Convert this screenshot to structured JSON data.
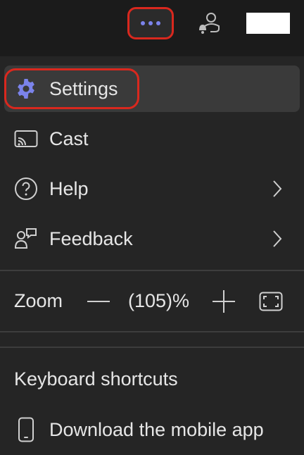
{
  "topbar": {
    "more_icon": "more-horizontal-icon",
    "person_icon": "person-notification-icon"
  },
  "menu": {
    "items": [
      {
        "label": "Settings",
        "icon": "gear-icon"
      },
      {
        "label": "Cast",
        "icon": "cast-icon"
      },
      {
        "label": "Help",
        "icon": "help-circle-icon"
      },
      {
        "label": "Feedback",
        "icon": "feedback-icon"
      }
    ],
    "zoom": {
      "label": "Zoom",
      "value": "(105)%"
    },
    "keyboard_shortcuts": "Keyboard shortcuts",
    "download_app": {
      "label": "Download the mobile app",
      "icon": "mobile-phone-icon"
    }
  },
  "colors": {
    "accent": "#7b83eb",
    "highlight": "#d9281e",
    "background": "#252525"
  }
}
